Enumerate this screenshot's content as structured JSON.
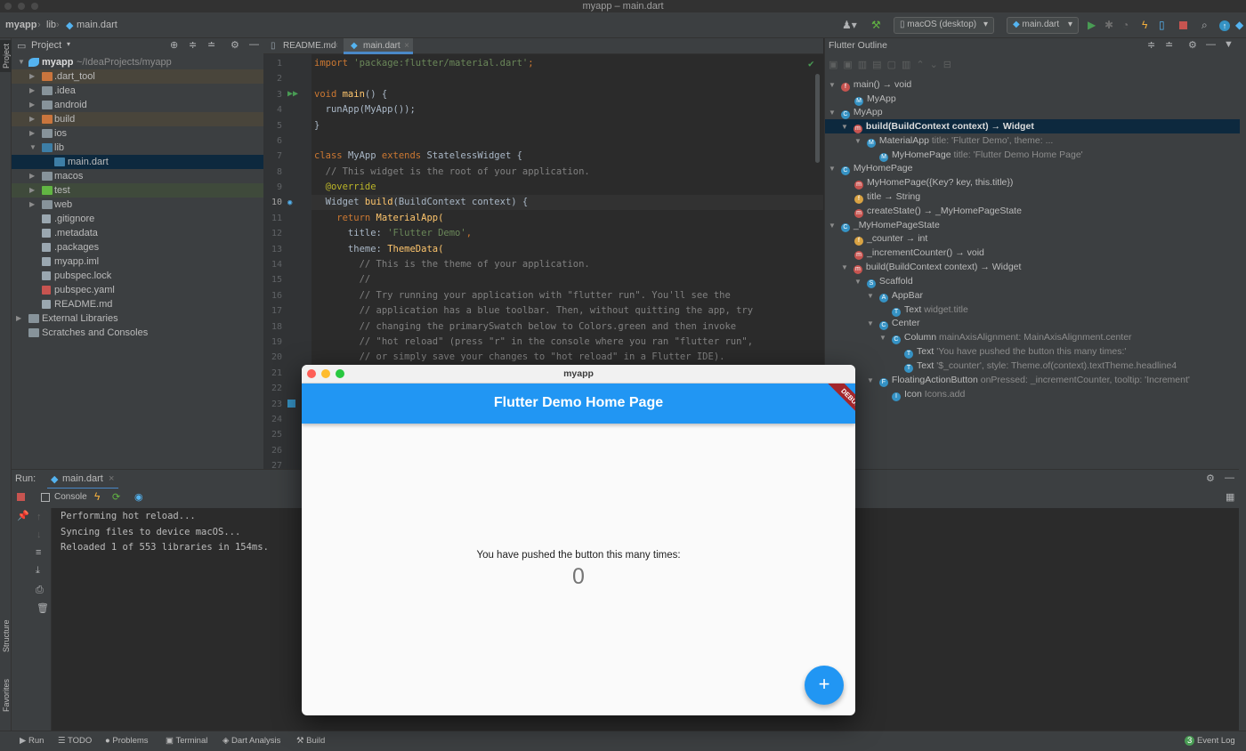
{
  "window": {
    "title": "myapp – main.dart"
  },
  "navbar": {
    "breadcrumbs": [
      "myapp",
      "lib",
      "main.dart"
    ],
    "device": "macOS (desktop)",
    "run_config": "main.dart"
  },
  "project_panel": {
    "title": "Project",
    "root": "myapp",
    "root_path": "~/IdeaProjects/myapp",
    "items": [
      ".dart_tool",
      ".idea",
      "android",
      "build",
      "ios",
      "lib",
      "main.dart",
      "macos",
      "test",
      "web",
      ".gitignore",
      ".metadata",
      ".packages",
      "myapp.iml",
      "pubspec.lock",
      "pubspec.yaml",
      "README.md",
      "External Libraries",
      "Scratches and Consoles"
    ]
  },
  "editor": {
    "tabs": [
      "README.md",
      "main.dart"
    ],
    "line_numbers": [
      "1",
      "2",
      "3",
      "4",
      "5",
      "6",
      "7",
      "8",
      "9",
      "10",
      "11",
      "12",
      "13",
      "14",
      "15",
      "16",
      "17",
      "18",
      "19",
      "20",
      "21",
      "22",
      "23",
      "24",
      "25",
      "26",
      "27"
    ],
    "lines": {
      "l1a": "import ",
      "l1b": "'package:flutter/material.dart'",
      "l1c": ";",
      "l3a": "void ",
      "l3b": "main",
      "l3c": "() {",
      "l4": "  runApp(MyApp());",
      "l5": "}",
      "l7a": "class ",
      "l7b": "MyApp ",
      "l7c": "extends ",
      "l7d": "StatelessWidget {",
      "l8": "  // This widget is the root of your application.",
      "l9": "  @override",
      "l10a": "  Widget ",
      "l10b": "build",
      "l10c": "(BuildContext context) {",
      "l11a": "    return ",
      "l11b": "MaterialApp(",
      "l12a": "      title: ",
      "l12b": "'Flutter Demo'",
      "l12c": ",",
      "l13a": "      theme: ",
      "l13b": "ThemeData(",
      "l14": "        // This is the theme of your application.",
      "l15": "        //",
      "l16": "        // Try running your application with \"flutter run\". You'll see the",
      "l17": "        // application has a blue toolbar. Then, without quitting the app, try",
      "l18": "        // changing the primarySwatch below to Colors.green and then invoke",
      "l19": "        // \"hot reload\" (press \"r\" in the console where you ran \"flutter run\",",
      "l20": "        // or simply save your changes to \"hot reload\" in a Flutter IDE)."
    }
  },
  "outline": {
    "title": "Flutter Outline",
    "rows": [
      {
        "badge": "f",
        "color": "#c75450",
        "name": "main() → void",
        "detail": ""
      },
      {
        "badge": "M",
        "color": "#3592c4",
        "name": "MyApp",
        "detail": ""
      },
      {
        "badge": "C",
        "color": "#3592c4",
        "name": "MyApp",
        "detail": ""
      },
      {
        "badge": "m",
        "color": "#c75450",
        "name": "build(BuildContext context) → Widget",
        "detail": ""
      },
      {
        "badge": "M",
        "color": "#3592c4",
        "name": "MaterialApp",
        "detail": "title: 'Flutter Demo', theme: ..."
      },
      {
        "badge": "M",
        "color": "#3592c4",
        "name": "MyHomePage",
        "detail": "title: 'Flutter Demo Home Page'"
      },
      {
        "badge": "C",
        "color": "#3592c4",
        "name": "MyHomePage",
        "detail": ""
      },
      {
        "badge": "m",
        "color": "#c75450",
        "name": "MyHomePage({Key? key, this.title})",
        "detail": ""
      },
      {
        "badge": "f",
        "color": "#d9a343",
        "name": "title → String",
        "detail": ""
      },
      {
        "badge": "m",
        "color": "#c75450",
        "name": "createState() → _MyHomePageState",
        "detail": ""
      },
      {
        "badge": "C",
        "color": "#3592c4",
        "name": "_MyHomePageState",
        "detail": ""
      },
      {
        "badge": "f",
        "color": "#d9a343",
        "name": "_counter → int",
        "detail": ""
      },
      {
        "badge": "m",
        "color": "#c75450",
        "name": "_incrementCounter() → void",
        "detail": ""
      },
      {
        "badge": "m",
        "color": "#c75450",
        "name": "build(BuildContext context) → Widget",
        "detail": ""
      },
      {
        "badge": "S",
        "color": "#3592c4",
        "name": "Scaffold",
        "detail": ""
      },
      {
        "badge": "A",
        "color": "#3592c4",
        "name": "AppBar",
        "detail": ""
      },
      {
        "badge": "T",
        "color": "#3592c4",
        "name": "Text",
        "detail": "widget.title"
      },
      {
        "badge": "C",
        "color": "#3592c4",
        "name": "Center",
        "detail": ""
      },
      {
        "badge": "C",
        "color": "#3592c4",
        "name": "Column",
        "detail": "mainAxisAlignment: MainAxisAlignment.center"
      },
      {
        "badge": "T",
        "color": "#3592c4",
        "name": "Text",
        "detail": "'You have pushed the button this many times:'"
      },
      {
        "badge": "T",
        "color": "#3592c4",
        "name": "Text",
        "detail": "'$_counter', style: Theme.of(context).textTheme.headline4"
      },
      {
        "badge": "F",
        "color": "#3592c4",
        "name": "FloatingActionButton",
        "detail": "onPressed: _incrementCounter, tooltip: 'Increment'"
      },
      {
        "badge": "I",
        "color": "#3592c4",
        "name": "Icon",
        "detail": "Icons.add"
      }
    ]
  },
  "run": {
    "label": "Run:",
    "tab": "main.dart",
    "console_tab": "Console",
    "output": [
      "Performing hot reload...",
      "Syncing files to device macOS...",
      "Reloaded 1 of 553 libraries in 154ms."
    ]
  },
  "statusbar": {
    "items": [
      "Run",
      "TODO",
      "Problems",
      "Terminal",
      "Dart Analysis",
      "Build"
    ],
    "event_log": "Event Log",
    "event_count": "3"
  },
  "side_stripes": {
    "left_top": "Project",
    "left_structure": "Structure",
    "left_favorites": "Favorites"
  },
  "app": {
    "window_title": "myapp",
    "appbar_title": "Flutter Demo Home Page",
    "debug_banner": "DEBUG",
    "message": "You have pushed the button this many times:",
    "counter": "0",
    "fab_icon": "+"
  }
}
